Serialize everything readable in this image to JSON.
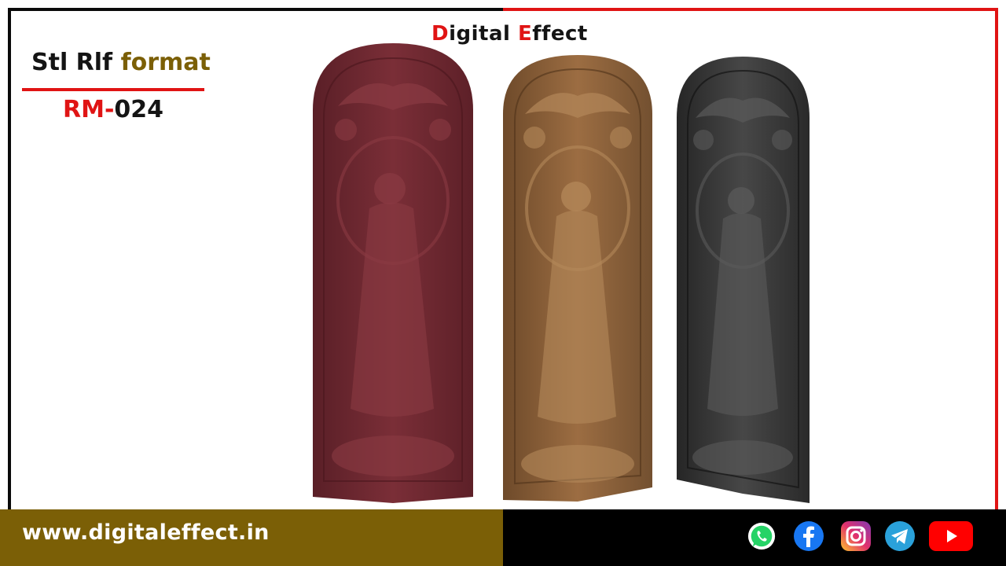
{
  "brand": {
    "first_letter": "D",
    "part1": "igital ",
    "second_letter": "E",
    "part2": "ffect"
  },
  "format_title": {
    "plain": "Stl Rlf ",
    "accent": "format"
  },
  "product_code": {
    "prefix": "RM-",
    "number": "024"
  },
  "footer": {
    "website": "www.digitaleffect.in",
    "socials": [
      "whatsapp-icon",
      "facebook-icon",
      "instagram-icon",
      "telegram-icon",
      "youtube-icon"
    ]
  },
  "panels": [
    {
      "name": "maroon-relief-panel",
      "color": "#6e2830"
    },
    {
      "name": "wood-relief-panel",
      "color": "#8a6038"
    },
    {
      "name": "black-relief-panel",
      "color": "#3c3c3c"
    }
  ],
  "colors": {
    "red": "#e01414",
    "gold": "#7b5f06",
    "black": "#000000"
  }
}
